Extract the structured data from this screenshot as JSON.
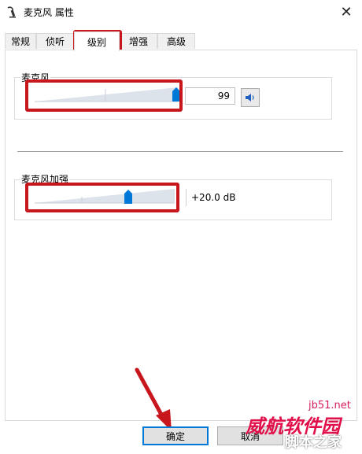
{
  "window": {
    "title": "麦克风 属性",
    "close_glyph": "✕"
  },
  "tabs": [
    {
      "label": "常规",
      "active": false
    },
    {
      "label": "侦听",
      "active": false
    },
    {
      "label": "级别",
      "active": true
    },
    {
      "label": "增强",
      "active": false
    },
    {
      "label": "高级",
      "active": false
    }
  ],
  "levels": {
    "microphone": {
      "label": "麦克风",
      "value_text": "99",
      "level_fraction": 0.99,
      "mute_icon": "speaker-icon"
    },
    "boost": {
      "label": "麦克风加强",
      "value_text": "+20.0 dB",
      "level_fraction": 0.67
    }
  },
  "buttons": {
    "ok": "确定",
    "cancel": "取消"
  },
  "watermark": {
    "site": "jb51.net",
    "cn_top": "威航软件园",
    "cn_bottom": "脚本之家"
  },
  "colors": {
    "accent": "#0078d7",
    "annotation_red": "#c8161d",
    "slider_track": "#dde3ea"
  }
}
